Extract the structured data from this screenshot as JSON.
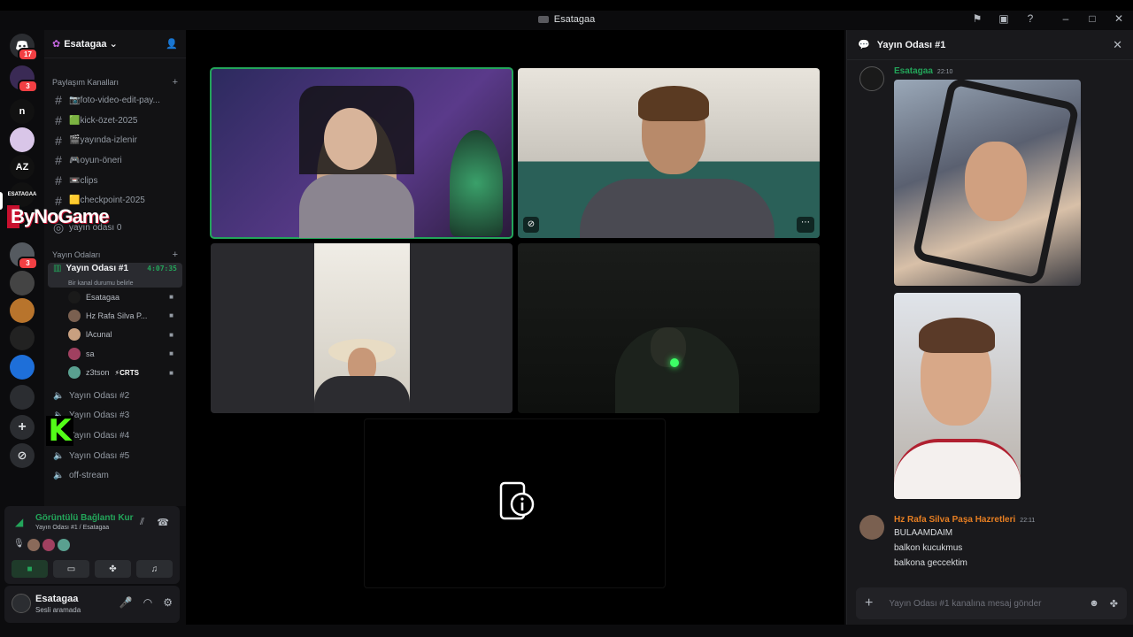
{
  "window": {
    "title": "Esatagaa"
  },
  "server": {
    "name": "Esatagaa",
    "mention_count": "17"
  },
  "guild_badges": {
    "g2": "3",
    "g5": "3"
  },
  "guild_letters": {
    "n": "n",
    "az": "AZ"
  },
  "categories": {
    "share": "Paylaşım Kanalları",
    "broadcast": "Yayın Odaları"
  },
  "text_channels": [
    {
      "name": "📷foto-video-edit-pay..."
    },
    {
      "name": "🟩kick-özet-2025"
    },
    {
      "name": "🎬yayında-izlenir"
    },
    {
      "name": "🎮oyun-öneri"
    },
    {
      "name": "📼clips"
    },
    {
      "name": "🟨checkpoint-2025"
    }
  ],
  "stage_channel": {
    "name": "yayın odası 0"
  },
  "active_voice": {
    "name": "Yayın Odası #1",
    "timer": "4:07:35",
    "status": "Bir kanal durumu belirle"
  },
  "voice_users": [
    {
      "name": "Esatagaa"
    },
    {
      "name": "Hz Rafa Silva P..."
    },
    {
      "name": "lAcunal"
    },
    {
      "name": "sa"
    },
    {
      "name": "z3tson",
      "tag": "⚡CRTS"
    }
  ],
  "voice_channels": [
    {
      "name": "Yayın Odası #2"
    },
    {
      "name": "Yayın Odası #3"
    },
    {
      "name": "Yayın Odası #4"
    },
    {
      "name": "Yayın Odası #5"
    },
    {
      "name": "off-stream"
    }
  ],
  "overlay": {
    "bynogame": "ByNoGame",
    "kick": "K"
  },
  "voice_panel": {
    "status": "Görüntülü Bağlantı Kur",
    "location": "Yayın Odası #1 / Esatagaa"
  },
  "user": {
    "name": "Esatagaa",
    "status": "Sesli aramada"
  },
  "chat": {
    "title": "Yayın Odası #1",
    "input_placeholder": "Yayın Odası #1 kanalına mesaj gönder",
    "messages": [
      {
        "author": "Esatagaa",
        "time": "22:10",
        "color": "#23a55a",
        "lines": []
      },
      {
        "author": "Hz Rafa Silva Paşa Hazretleri",
        "time": "22:11",
        "color": "#e67e22",
        "lines": [
          "BULAAMDAIM",
          "balkon kucukmus",
          "balkona geccektim"
        ]
      }
    ]
  },
  "colors": {
    "online": "#23a55a",
    "accent": "#5865f2",
    "danger": "#f23f43"
  }
}
